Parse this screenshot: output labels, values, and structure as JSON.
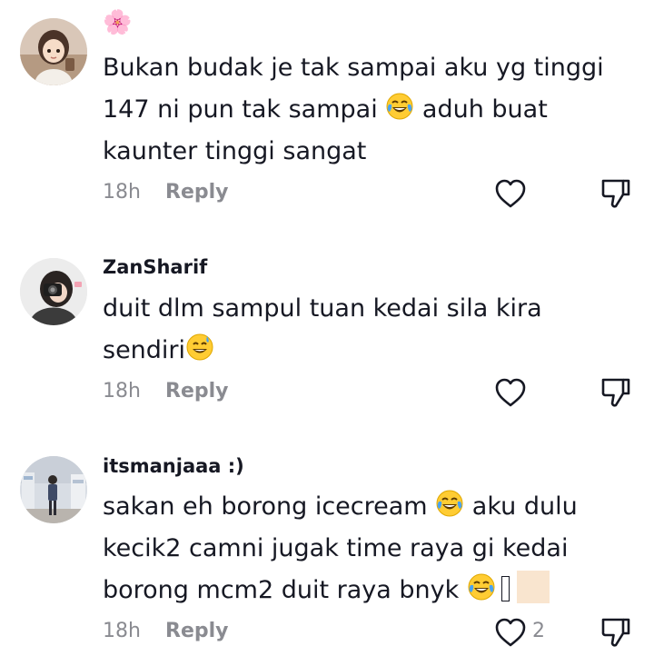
{
  "comments": [
    {
      "username": "🌸",
      "lines": [
        "Bukan budak je tak sampai aku yg tinggi",
        "147 ni pun tak sampai",
        "aduh buat",
        "kaunter tinggi sangat"
      ],
      "time": "18h",
      "reply_label": "Reply",
      "like_count": ""
    },
    {
      "username": "ZanSharif",
      "lines": [
        "duit dlm sampul tuan kedai sila kira",
        "sendiri"
      ],
      "time": "18h",
      "reply_label": "Reply",
      "like_count": ""
    },
    {
      "username": "itsmanjaaa :)",
      "lines": [
        "sakan eh borong icecream",
        "aku dulu",
        "kecik2 camni jugak time raya gi kedai",
        "borong mcm2 duit raya bnyk"
      ],
      "time": "18h",
      "reply_label": "Reply",
      "like_count": "2"
    }
  ],
  "colors": {
    "text": "#161823",
    "muted": "#8a8b91",
    "skin_tone": "#f9e5cf"
  },
  "icons": {
    "like": "heart-outline-icon",
    "dislike": "thumbs-down-outline-icon",
    "laugh": "face-with-tears-of-joy-icon",
    "sweat_smile": "grinning-face-with-sweat-icon"
  }
}
